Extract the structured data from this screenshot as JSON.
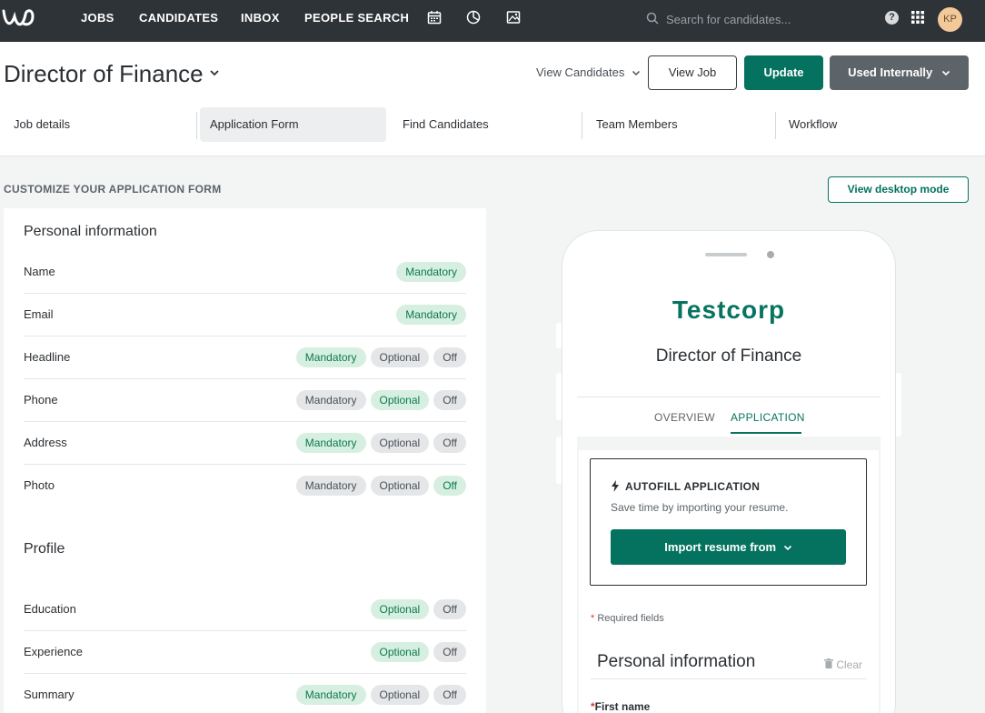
{
  "nav": {
    "links": [
      "JOBS",
      "CANDIDATES",
      "INBOX",
      "PEOPLE SEARCH"
    ],
    "icons": [
      "calendar-icon",
      "pie-chart-icon",
      "image-icon"
    ],
    "search_placeholder": "Search for candidates...",
    "help_glyph": "?",
    "avatar_initials": "KP"
  },
  "header": {
    "job_title": "Director of Finance",
    "view_candidates": "View Candidates",
    "view_job": "View Job",
    "update": "Update",
    "used_internally": "Used Internally"
  },
  "tabs": [
    "Job details",
    "Application Form",
    "Find Candidates",
    "Team Members",
    "Workflow"
  ],
  "section": {
    "title": "CUSTOMIZE YOUR APPLICATION FORM",
    "desktop_button": "View desktop mode"
  },
  "personal": {
    "title": "Personal information",
    "rows": [
      {
        "label": "Name",
        "options": [
          "Mandatory"
        ],
        "selected": "Mandatory"
      },
      {
        "label": "Email",
        "options": [
          "Mandatory"
        ],
        "selected": "Mandatory"
      },
      {
        "label": "Headline",
        "options": [
          "Mandatory",
          "Optional",
          "Off"
        ],
        "selected": "Mandatory"
      },
      {
        "label": "Phone",
        "options": [
          "Mandatory",
          "Optional",
          "Off"
        ],
        "selected": "Optional"
      },
      {
        "label": "Address",
        "options": [
          "Mandatory",
          "Optional",
          "Off"
        ],
        "selected": "Mandatory"
      },
      {
        "label": "Photo",
        "options": [
          "Mandatory",
          "Optional",
          "Off"
        ],
        "selected": "Off"
      }
    ]
  },
  "profile": {
    "title": "Profile",
    "rows": [
      {
        "label": "Education",
        "options": [
          "Optional",
          "Off"
        ],
        "selected": "Optional"
      },
      {
        "label": "Experience",
        "options": [
          "Optional",
          "Off"
        ],
        "selected": "Optional"
      },
      {
        "label": "Summary",
        "options": [
          "Mandatory",
          "Optional",
          "Off"
        ],
        "selected": "Mandatory"
      }
    ]
  },
  "preview": {
    "company": "Testcorp",
    "job_title": "Director of Finance",
    "tab_overview": "OVERVIEW",
    "tab_application": "APPLICATION",
    "autofill_title": "AUTOFILL APPLICATION",
    "autofill_sub": "Save time by importing your resume.",
    "import_button": "Import resume from",
    "required_star": "*",
    "required_text": " Required fields",
    "personal_info": "Personal information",
    "clear": "Clear",
    "first_name": "First name"
  },
  "colors": {
    "nav_bg": "#2e3337",
    "primary": "#05725f",
    "pill_on_bg": "#d7efe0",
    "pill_on_text": "#0b7a4e"
  }
}
